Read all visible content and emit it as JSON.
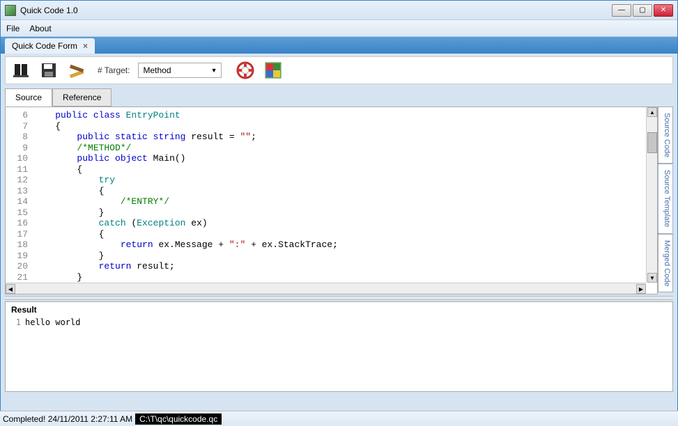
{
  "window": {
    "title": "Quick Code 1.0"
  },
  "menu": {
    "file": "File",
    "about": "About"
  },
  "doctab": {
    "label": "Quick Code Form"
  },
  "toolbar": {
    "target_label": "# Target:",
    "target_selected": "Method"
  },
  "innertabs": {
    "source": "Source",
    "reference": "Reference"
  },
  "sidetabs": {
    "source_code": "Source Code",
    "source_template": "Source Template",
    "merged_code": "Merged Code"
  },
  "code_lines": [
    {
      "n": 6,
      "tokens": [
        [
          "    ",
          ""
        ],
        [
          "public",
          "kw-blue"
        ],
        [
          " ",
          ""
        ],
        [
          "class",
          "kw-blue"
        ],
        [
          " ",
          ""
        ],
        [
          "EntryPoint",
          "kw-teal"
        ]
      ]
    },
    {
      "n": 7,
      "tokens": [
        [
          "    ",
          ""
        ],
        [
          "{",
          ""
        ]
      ]
    },
    {
      "n": 8,
      "tokens": [
        [
          "        ",
          ""
        ],
        [
          "public",
          "kw-blue"
        ],
        [
          " ",
          ""
        ],
        [
          "static",
          "kw-blue"
        ],
        [
          " ",
          ""
        ],
        [
          "string",
          "kw-blue"
        ],
        [
          " result = ",
          ""
        ],
        [
          "\"\"",
          "str"
        ],
        [
          ";",
          ""
        ]
      ]
    },
    {
      "n": 9,
      "tokens": [
        [
          "        ",
          ""
        ],
        [
          "/*METHOD*/",
          "comment"
        ]
      ]
    },
    {
      "n": 10,
      "tokens": [
        [
          "        ",
          ""
        ],
        [
          "public",
          "kw-blue"
        ],
        [
          " ",
          ""
        ],
        [
          "object",
          "kw-blue"
        ],
        [
          " Main()",
          ""
        ]
      ]
    },
    {
      "n": 11,
      "tokens": [
        [
          "        ",
          ""
        ],
        [
          "{",
          ""
        ]
      ]
    },
    {
      "n": 12,
      "tokens": [
        [
          "            ",
          ""
        ],
        [
          "try",
          "kw-teal"
        ]
      ]
    },
    {
      "n": 13,
      "tokens": [
        [
          "            ",
          ""
        ],
        [
          "{",
          ""
        ]
      ]
    },
    {
      "n": 14,
      "tokens": [
        [
          "                ",
          ""
        ],
        [
          "/*ENTRY*/",
          "comment"
        ]
      ]
    },
    {
      "n": 15,
      "tokens": [
        [
          "            ",
          ""
        ],
        [
          "}",
          ""
        ]
      ]
    },
    {
      "n": 16,
      "tokens": [
        [
          "            ",
          ""
        ],
        [
          "catch",
          "kw-teal"
        ],
        [
          " (",
          ""
        ],
        [
          "Exception",
          "kw-teal"
        ],
        [
          " ex)",
          ""
        ]
      ]
    },
    {
      "n": 17,
      "tokens": [
        [
          "            ",
          ""
        ],
        [
          "{",
          ""
        ]
      ]
    },
    {
      "n": 18,
      "tokens": [
        [
          "                ",
          ""
        ],
        [
          "return",
          "kw-blue"
        ],
        [
          " ex.Message + ",
          ""
        ],
        [
          "\":\"",
          "str"
        ],
        [
          " + ex.StackTrace;",
          ""
        ]
      ]
    },
    {
      "n": 19,
      "tokens": [
        [
          "            ",
          ""
        ],
        [
          "}",
          ""
        ]
      ]
    },
    {
      "n": 20,
      "tokens": [
        [
          "            ",
          ""
        ],
        [
          "return",
          "kw-blue"
        ],
        [
          " result;",
          ""
        ]
      ]
    },
    {
      "n": 21,
      "tokens": [
        [
          "        ",
          ""
        ],
        [
          "}",
          ""
        ]
      ]
    }
  ],
  "result": {
    "title": "Result",
    "lines": [
      {
        "n": 1,
        "text": "hello world"
      }
    ]
  },
  "status": {
    "message": "Completed! 24/11/2011 2:27:11 AM",
    "path": "C:\\T\\qc\\quickcode.qc"
  }
}
